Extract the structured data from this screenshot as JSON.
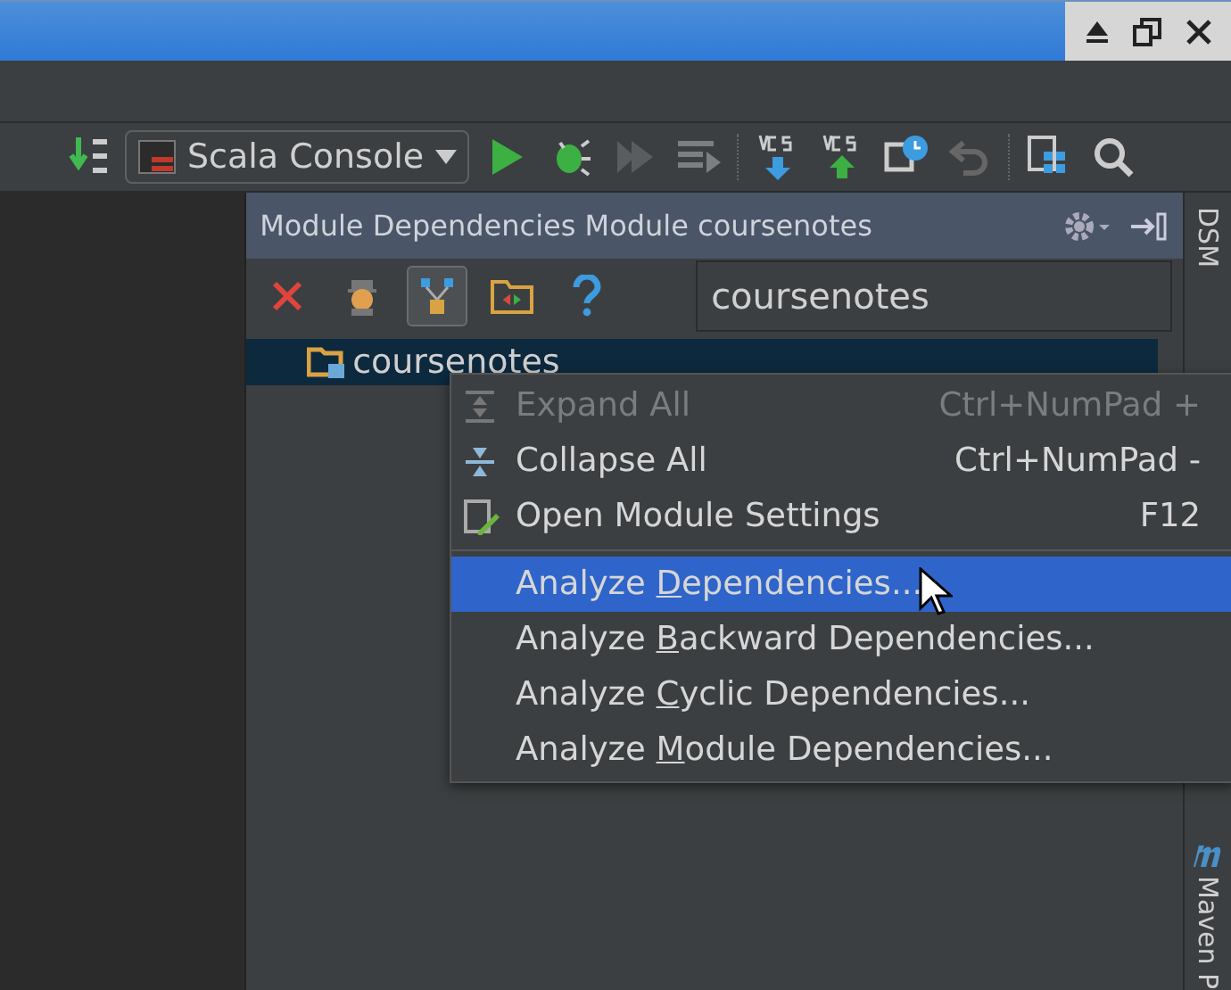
{
  "run_config": {
    "label": "Scala Console"
  },
  "panel": {
    "title": "Module Dependencies Module coursenotes",
    "search_value": "coursenotes",
    "flatten_selected": true,
    "tree": [
      {
        "label": "coursenotes",
        "selected": true
      }
    ]
  },
  "side_tabs": [
    {
      "label": "DSM"
    },
    {
      "label": "Maven P"
    }
  ],
  "context_menu": {
    "groups": [
      [
        {
          "kind": "expand",
          "label_parts": [
            "Expand All"
          ],
          "shortcut": "Ctrl+NumPad +",
          "disabled": true,
          "selected": false
        },
        {
          "kind": "collapse",
          "label_parts": [
            "Collapse All"
          ],
          "shortcut": "Ctrl+NumPad -",
          "disabled": false,
          "selected": false
        },
        {
          "kind": "settings",
          "label_parts": [
            "Open Module Settings"
          ],
          "shortcut": "F12",
          "disabled": false,
          "selected": false
        }
      ],
      [
        {
          "kind": "plain",
          "label_parts": [
            "Analyze ",
            "D",
            "ependencies..."
          ],
          "disabled": false,
          "selected": true
        },
        {
          "kind": "plain",
          "label_parts": [
            "Analyze ",
            "B",
            "ackward Dependencies..."
          ],
          "disabled": false,
          "selected": false
        },
        {
          "kind": "plain",
          "label_parts": [
            "Analyze ",
            "C",
            "yclic Dependencies..."
          ],
          "disabled": false,
          "selected": false
        },
        {
          "kind": "plain",
          "label_parts": [
            "Analyze ",
            "M",
            "odule Dependencies..."
          ],
          "disabled": false,
          "selected": false
        }
      ]
    ]
  }
}
